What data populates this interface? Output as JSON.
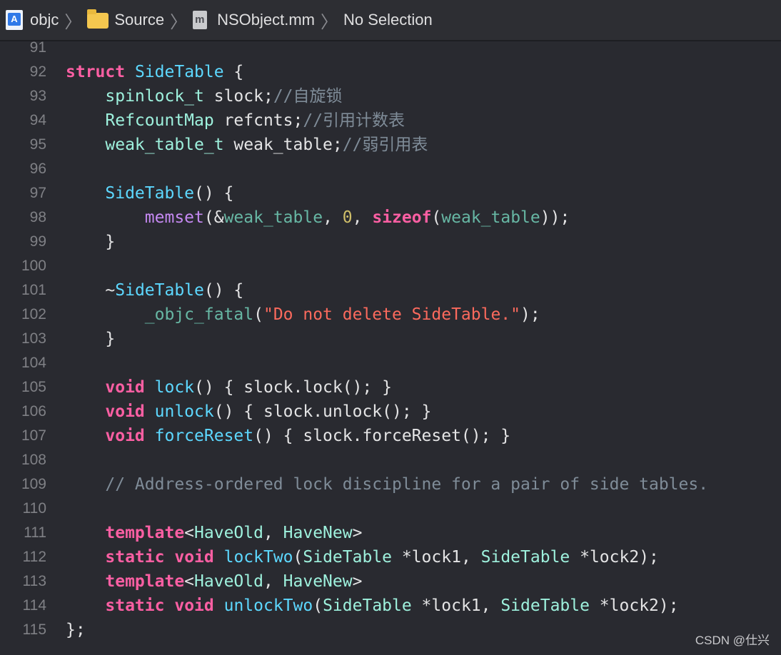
{
  "jumpbar": {
    "project": "objc",
    "folder": "Source",
    "file": "NSObject.mm",
    "selection": "No Selection"
  },
  "icons": {
    "project": "xcode-project-icon",
    "folder": "folder-icon",
    "file": "objc-source-file-icon"
  },
  "colors": {
    "background": "#292a30",
    "keyword": "#fc5fa3",
    "type": "#5dd8ff",
    "other_type": "#9ef1dd",
    "function": "#67b7a4",
    "comment": "#7f8c98",
    "string": "#fc6a5d",
    "number": "#d0bf69",
    "plain": "#e4e4e5"
  },
  "lines": [
    {
      "num": "91",
      "tokens": []
    },
    {
      "num": "92",
      "tokens": [
        [
          "struct",
          "kw"
        ],
        [
          " ",
          "pl"
        ],
        [
          "SideTable",
          "ty"
        ],
        [
          " {",
          "pl"
        ]
      ]
    },
    {
      "num": "93",
      "tokens": [
        [
          "    ",
          "pl"
        ],
        [
          "spinlock_t",
          "ot"
        ],
        [
          " slock;",
          "pl"
        ],
        [
          "//自旋锁",
          "cm"
        ]
      ]
    },
    {
      "num": "94",
      "tokens": [
        [
          "    ",
          "pl"
        ],
        [
          "RefcountMap",
          "ot"
        ],
        [
          " refcnts;",
          "pl"
        ],
        [
          "//引用计数表",
          "cm"
        ]
      ]
    },
    {
      "num": "95",
      "tokens": [
        [
          "    ",
          "pl"
        ],
        [
          "weak_table_t",
          "ot"
        ],
        [
          " weak_table;",
          "pl"
        ],
        [
          "//弱引用表",
          "cm"
        ]
      ]
    },
    {
      "num": "96",
      "tokens": []
    },
    {
      "num": "97",
      "tokens": [
        [
          "    ",
          "pl"
        ],
        [
          "SideTable",
          "ty"
        ],
        [
          "() {",
          "pl"
        ]
      ]
    },
    {
      "num": "98",
      "tokens": [
        [
          "        ",
          "pl"
        ],
        [
          "memset",
          "mc"
        ],
        [
          "(&",
          "pl"
        ],
        [
          "weak_table",
          "fn"
        ],
        [
          ", ",
          "pl"
        ],
        [
          "0",
          "nm"
        ],
        [
          ", ",
          "pl"
        ],
        [
          "sizeof",
          "kw"
        ],
        [
          "(",
          "pl"
        ],
        [
          "weak_table",
          "fn"
        ],
        [
          "));",
          "pl"
        ]
      ]
    },
    {
      "num": "99",
      "tokens": [
        [
          "    }",
          "pl"
        ]
      ]
    },
    {
      "num": "100",
      "tokens": []
    },
    {
      "num": "101",
      "tokens": [
        [
          "    ~",
          "pl"
        ],
        [
          "SideTable",
          "ty"
        ],
        [
          "() {",
          "pl"
        ]
      ]
    },
    {
      "num": "102",
      "tokens": [
        [
          "        ",
          "pl"
        ],
        [
          "_objc_fatal",
          "fn"
        ],
        [
          "(",
          "pl"
        ],
        [
          "\"Do not delete SideTable.\"",
          "st"
        ],
        [
          ");",
          "pl"
        ]
      ]
    },
    {
      "num": "103",
      "tokens": [
        [
          "    }",
          "pl"
        ]
      ]
    },
    {
      "num": "104",
      "tokens": []
    },
    {
      "num": "105",
      "tokens": [
        [
          "    ",
          "pl"
        ],
        [
          "void",
          "kw"
        ],
        [
          " ",
          "pl"
        ],
        [
          "lock",
          "ty"
        ],
        [
          "() { slock.lock(); }",
          "pl"
        ]
      ]
    },
    {
      "num": "106",
      "tokens": [
        [
          "    ",
          "pl"
        ],
        [
          "void",
          "kw"
        ],
        [
          " ",
          "pl"
        ],
        [
          "unlock",
          "ty"
        ],
        [
          "() { slock.unlock(); }",
          "pl"
        ]
      ]
    },
    {
      "num": "107",
      "tokens": [
        [
          "    ",
          "pl"
        ],
        [
          "void",
          "kw"
        ],
        [
          " ",
          "pl"
        ],
        [
          "forceReset",
          "ty"
        ],
        [
          "() { slock.forceReset(); }",
          "pl"
        ]
      ]
    },
    {
      "num": "108",
      "tokens": []
    },
    {
      "num": "109",
      "tokens": [
        [
          "    ",
          "pl"
        ],
        [
          "// Address-ordered lock discipline for a pair of side tables.",
          "cm"
        ]
      ]
    },
    {
      "num": "110",
      "tokens": []
    },
    {
      "num": "111",
      "tokens": [
        [
          "    ",
          "pl"
        ],
        [
          "template",
          "kw"
        ],
        [
          "<",
          "pl"
        ],
        [
          "HaveOld",
          "ot"
        ],
        [
          ", ",
          "pl"
        ],
        [
          "HaveNew",
          "ot"
        ],
        [
          ">",
          "pl"
        ]
      ]
    },
    {
      "num": "112",
      "tokens": [
        [
          "    ",
          "pl"
        ],
        [
          "static",
          "kw"
        ],
        [
          " ",
          "pl"
        ],
        [
          "void",
          "kw"
        ],
        [
          " ",
          "pl"
        ],
        [
          "lockTwo",
          "ty"
        ],
        [
          "(",
          "pl"
        ],
        [
          "SideTable",
          "ot"
        ],
        [
          " *lock1, ",
          "pl"
        ],
        [
          "SideTable",
          "ot"
        ],
        [
          " *lock2);",
          "pl"
        ]
      ]
    },
    {
      "num": "113",
      "tokens": [
        [
          "    ",
          "pl"
        ],
        [
          "template",
          "kw"
        ],
        [
          "<",
          "pl"
        ],
        [
          "HaveOld",
          "ot"
        ],
        [
          ", ",
          "pl"
        ],
        [
          "HaveNew",
          "ot"
        ],
        [
          ">",
          "pl"
        ]
      ]
    },
    {
      "num": "114",
      "tokens": [
        [
          "    ",
          "pl"
        ],
        [
          "static",
          "kw"
        ],
        [
          " ",
          "pl"
        ],
        [
          "void",
          "kw"
        ],
        [
          " ",
          "pl"
        ],
        [
          "unlockTwo",
          "ty"
        ],
        [
          "(",
          "pl"
        ],
        [
          "SideTable",
          "ot"
        ],
        [
          " *lock1, ",
          "pl"
        ],
        [
          "SideTable",
          "ot"
        ],
        [
          " *lock2);",
          "pl"
        ]
      ]
    },
    {
      "num": "115",
      "tokens": [
        [
          "};",
          "pl"
        ]
      ]
    }
  ],
  "watermark": "CSDN @仕兴"
}
